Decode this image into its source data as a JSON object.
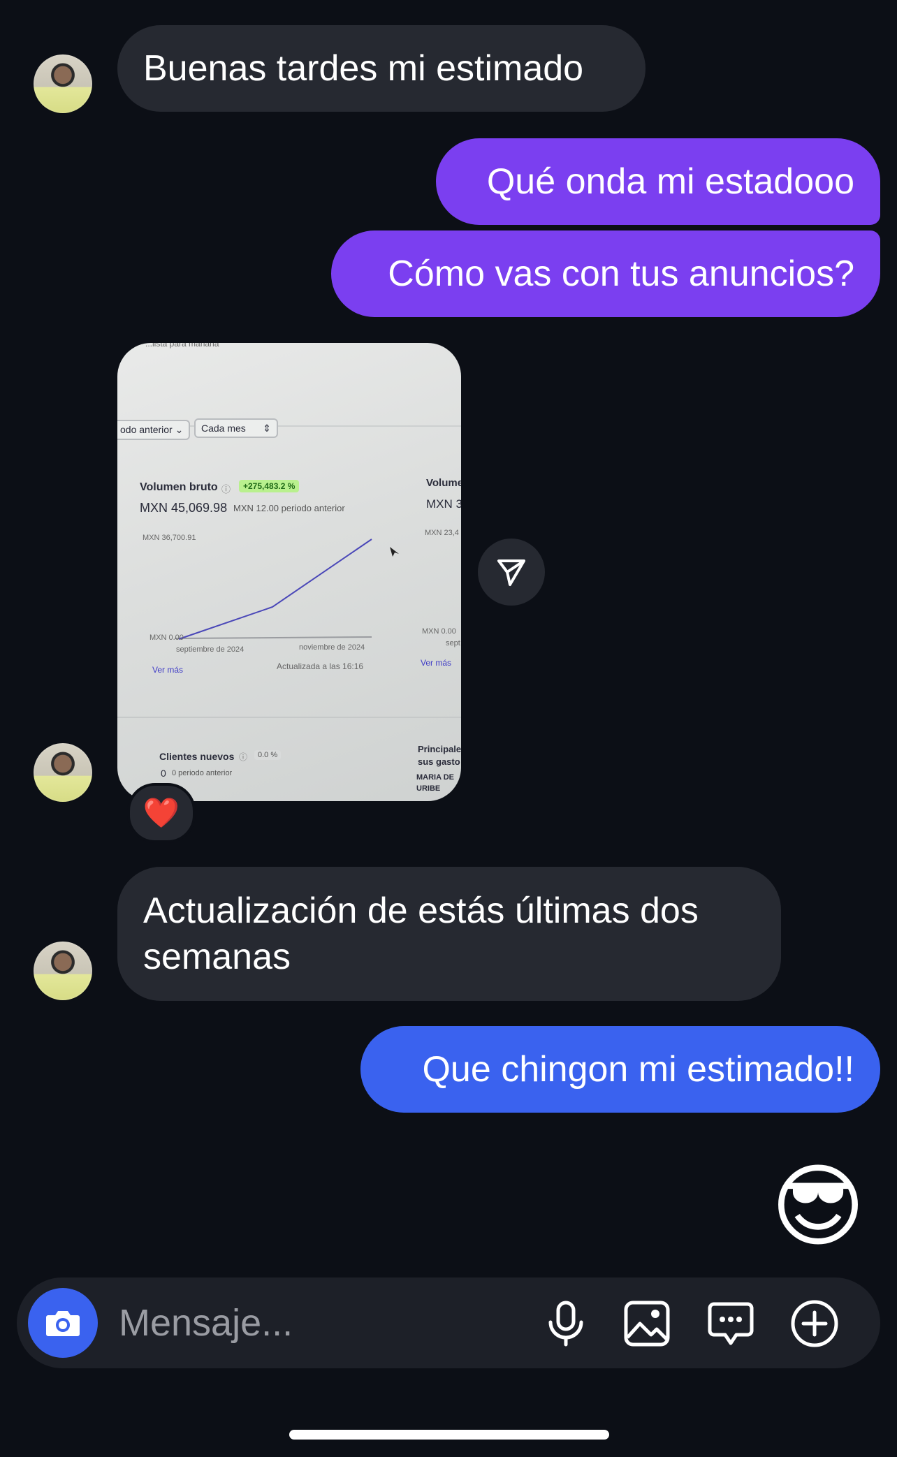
{
  "messages": {
    "m1": "Buenas tardes mi estimado",
    "m2": "Qué onda mi estadooo",
    "m3": "Cómo vas con tus anuncios?",
    "m5": "Actualización de estás últimas dos semanas",
    "m6": "Que chingon mi estimado!!",
    "m7": "😎"
  },
  "photo": {
    "top_fragment": "...lista para mañana",
    "select1": "odo anterior",
    "select2": "Cada mes",
    "card1_title": "Volumen bruto",
    "card1_badge": "+275,483.2 %",
    "card1_value": "MXN 45,069.98",
    "card1_prev": "MXN 12.00 periodo anterior",
    "card1_ymax": "MXN 36,700.91",
    "card1_ymin": "MXN 0.00",
    "card1_x1": "septiembre de 2024",
    "card1_x2": "noviembre de 2024",
    "card1_link": "Ver más",
    "card1_updated": "Actualizada a las 16:16",
    "card2_title": "Volume",
    "card2_value": "MXN 3",
    "card2_ymax": "MXN 23,4",
    "card2_ymin": "MXN 0.00",
    "card2_x1": "sept",
    "card2_link": "Ver más",
    "card3_title": "Clientes nuevos",
    "card3_badge": "0.0 %",
    "card3_value": "0",
    "card3_prev": "0 periodo anterior",
    "card4_title1": "Principale",
    "card4_title2": "sus gasto",
    "card4_name1": "MARIA DE",
    "card4_name2": "URIBE"
  },
  "reaction": "❤️",
  "composer": {
    "placeholder": "Mensaje..."
  },
  "icons": {
    "camera": "camera-icon",
    "mic": "microphone-icon",
    "gallery": "image-icon",
    "sticker": "chat-bubble-icon",
    "add": "plus-circle-icon",
    "share": "send-icon"
  },
  "colors": {
    "background": "#0c0f16",
    "incoming_bubble": "#262931",
    "outgoing_purple": "#7b3ff0",
    "outgoing_blue": "#3a62ef",
    "composer": "#1d2028"
  }
}
